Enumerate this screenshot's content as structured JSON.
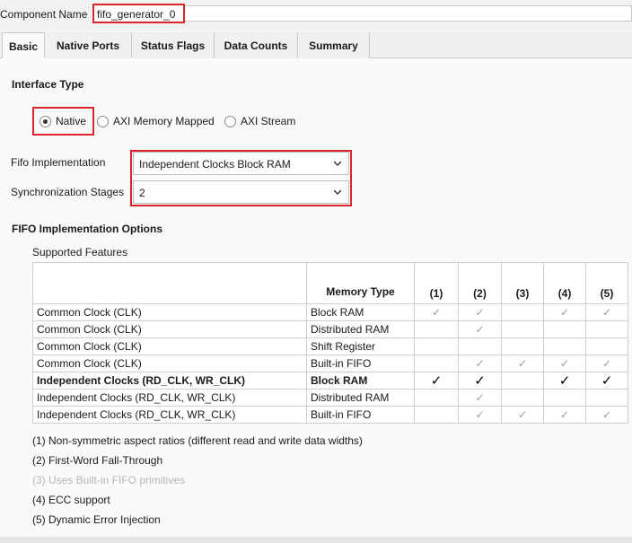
{
  "component": {
    "label": "Component Name",
    "value": "fifo_generator_0"
  },
  "tabs": [
    {
      "label": "Basic",
      "active": true
    },
    {
      "label": "Native Ports",
      "active": false
    },
    {
      "label": "Status Flags",
      "active": false
    },
    {
      "label": "Data Counts",
      "active": false
    },
    {
      "label": "Summary",
      "active": false
    }
  ],
  "interface_type": {
    "title": "Interface Type",
    "options": [
      {
        "label": "Native",
        "checked": true
      },
      {
        "label": "AXI Memory Mapped",
        "checked": false
      },
      {
        "label": "AXI Stream",
        "checked": false
      }
    ]
  },
  "fifo_implementation": {
    "label": "Fifo Implementation",
    "value": "Independent Clocks Block RAM"
  },
  "sync_stages": {
    "label": "Synchronization Stages",
    "value": "2"
  },
  "options": {
    "title": "FIFO Implementation Options",
    "supported_features": "Supported Features",
    "headers": {
      "memory_type": "Memory Type",
      "cols": [
        "(1)",
        "(2)",
        "(3)",
        "(4)",
        "(5)"
      ]
    },
    "tick_glyph": "✓",
    "rows": [
      {
        "clock": "Common Clock (CLK)",
        "memory": "Block RAM",
        "features": [
          true,
          true,
          false,
          true,
          true
        ],
        "bold": false
      },
      {
        "clock": "Common Clock (CLK)",
        "memory": "Distributed RAM",
        "features": [
          false,
          true,
          false,
          false,
          false
        ],
        "bold": false
      },
      {
        "clock": "Common Clock (CLK)",
        "memory": "Shift Register",
        "features": [
          false,
          false,
          false,
          false,
          false
        ],
        "bold": false
      },
      {
        "clock": "Common Clock (CLK)",
        "memory": "Built-in FIFO",
        "features": [
          false,
          true,
          true,
          true,
          true
        ],
        "bold": false
      },
      {
        "clock": "Independent Clocks (RD_CLK, WR_CLK)",
        "memory": "Block RAM",
        "features": [
          true,
          true,
          false,
          true,
          true
        ],
        "bold": true
      },
      {
        "clock": "Independent Clocks (RD_CLK, WR_CLK)",
        "memory": "Distributed RAM",
        "features": [
          false,
          true,
          false,
          false,
          false
        ],
        "bold": false
      },
      {
        "clock": "Independent Clocks (RD_CLK, WR_CLK)",
        "memory": "Built-in FIFO",
        "features": [
          false,
          true,
          true,
          true,
          true
        ],
        "bold": false
      }
    ],
    "notes": [
      {
        "text": "(1) Non-symmetric aspect ratios (different read and write data widths)",
        "dim": false
      },
      {
        "text": "(2) First-Word Fall-Through",
        "dim": false
      },
      {
        "text": "(3) Uses Built-in FIFO primitives",
        "dim": true
      },
      {
        "text": "(4) ECC support",
        "dim": false
      },
      {
        "text": "(5) Dynamic Error Injection",
        "dim": false
      }
    ]
  },
  "colors": {
    "highlight": "#d9262b",
    "tick_dim": "#9a9a9a"
  }
}
